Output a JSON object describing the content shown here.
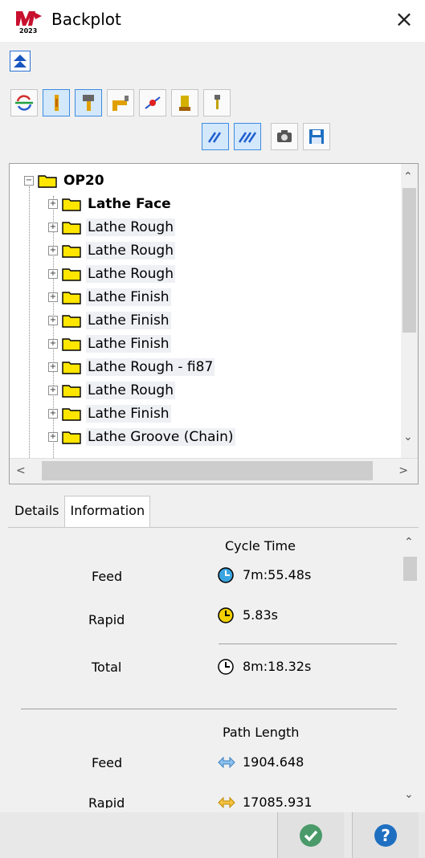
{
  "window": {
    "title": "Backplot",
    "close_glyph": "×"
  },
  "toolbar": {
    "collapse_icon": "double-up-arrow-icon",
    "row1": [
      {
        "name": "refresh-cycle-icon",
        "active": false
      },
      {
        "name": "tool-icon",
        "active": true
      },
      {
        "name": "tool-holder-icon",
        "active": true
      },
      {
        "name": "holder-icon",
        "active": false
      },
      {
        "name": "endpoint-icon",
        "active": false
      },
      {
        "name": "stock-icon",
        "active": false
      },
      {
        "name": "verify-tool-icon",
        "active": false
      }
    ],
    "row2": [
      {
        "name": "toolpath-hatch-icon",
        "active": true
      },
      {
        "name": "toolpath-hatch-double-icon",
        "active": true
      },
      {
        "name": "camera-icon",
        "active": false
      },
      {
        "name": "save-icon",
        "active": false
      }
    ]
  },
  "tree": {
    "root": {
      "label": "OP20"
    },
    "items": [
      {
        "label": "Lathe Face",
        "bold": true
      },
      {
        "label": "Lathe Rough",
        "bold": false
      },
      {
        "label": "Lathe Rough",
        "bold": false
      },
      {
        "label": "Lathe Rough",
        "bold": false
      },
      {
        "label": "Lathe Finish",
        "bold": false
      },
      {
        "label": "Lathe Finish",
        "bold": false
      },
      {
        "label": "Lathe Finish",
        "bold": false
      },
      {
        "label": "Lathe Rough - fi87",
        "bold": false
      },
      {
        "label": "Lathe Rough",
        "bold": false
      },
      {
        "label": "Lathe Finish",
        "bold": false
      },
      {
        "label": "Lathe Groove (Chain)",
        "bold": false
      }
    ]
  },
  "tabs": [
    {
      "label": "Details",
      "active": false
    },
    {
      "label": "Information",
      "active": true
    }
  ],
  "info": {
    "cycle_time": {
      "header": "Cycle Time",
      "feed_label": "Feed",
      "feed_value": "7m:55.48s",
      "rapid_label": "Rapid",
      "rapid_value": "5.83s",
      "total_label": "Total",
      "total_value": "8m:18.32s"
    },
    "path_length": {
      "header": "Path Length",
      "feed_label": "Feed",
      "feed_value": "1904.648",
      "rapid_label": "Rapid",
      "rapid_value": "17085.931"
    }
  },
  "colors": {
    "folder_yellow": "#ffe600",
    "accent_blue": "#2a6fd4",
    "ok_green": "#4a9a6a",
    "help_blue": "#1f6fc1",
    "feed_clock": "#3aa4e0",
    "rapid_clock": "#f3d000"
  }
}
